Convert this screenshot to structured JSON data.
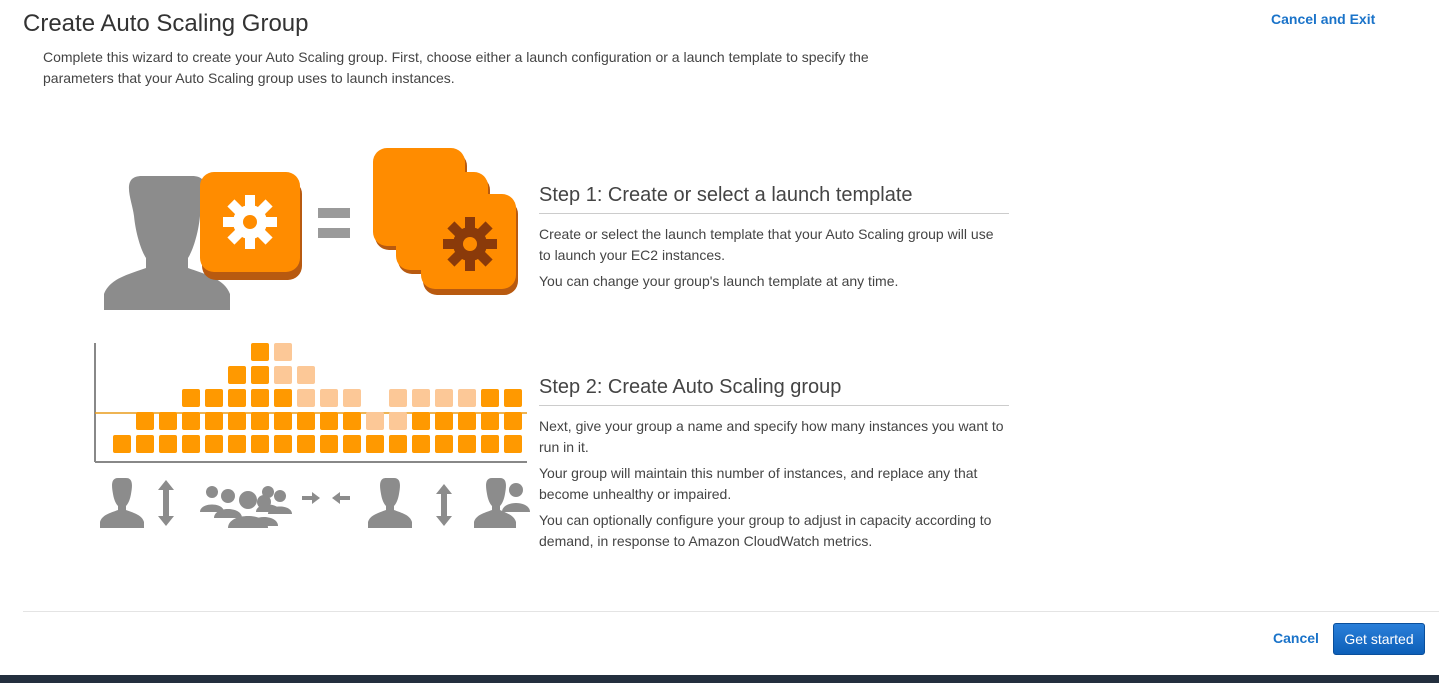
{
  "header": {
    "title": "Create Auto Scaling Group",
    "cancel_exit_label": "Cancel and Exit"
  },
  "intro": "Complete this wizard to create your Auto Scaling group. First, choose either a launch configuration or a launch template to specify the parameters that your Auto Scaling group uses to launch instances.",
  "steps": [
    {
      "title": "Step 1: Create or select a launch template",
      "paragraphs": [
        "Create or select the launch template that your Auto Scaling group will use to launch your EC2 instances.",
        "You can change your group's launch template at any time."
      ]
    },
    {
      "title": "Step 2: Create Auto Scaling group",
      "paragraphs": [
        "Next, give your group a name and specify how many instances you want to run in it.",
        "Your group will maintain this number of instances, and replace any that become unhealthy or impaired.",
        "You can optionally configure your group to adjust in capacity according to demand, in response to Amazon CloudWatch metrics."
      ]
    }
  ],
  "footer": {
    "cancel_label": "Cancel",
    "primary_label": "Get started"
  },
  "colors": {
    "accent_orange": "#ff9900",
    "light_orange": "#fcc897",
    "link_blue": "#1a73c9",
    "icon_gray": "#8c8c8c"
  }
}
